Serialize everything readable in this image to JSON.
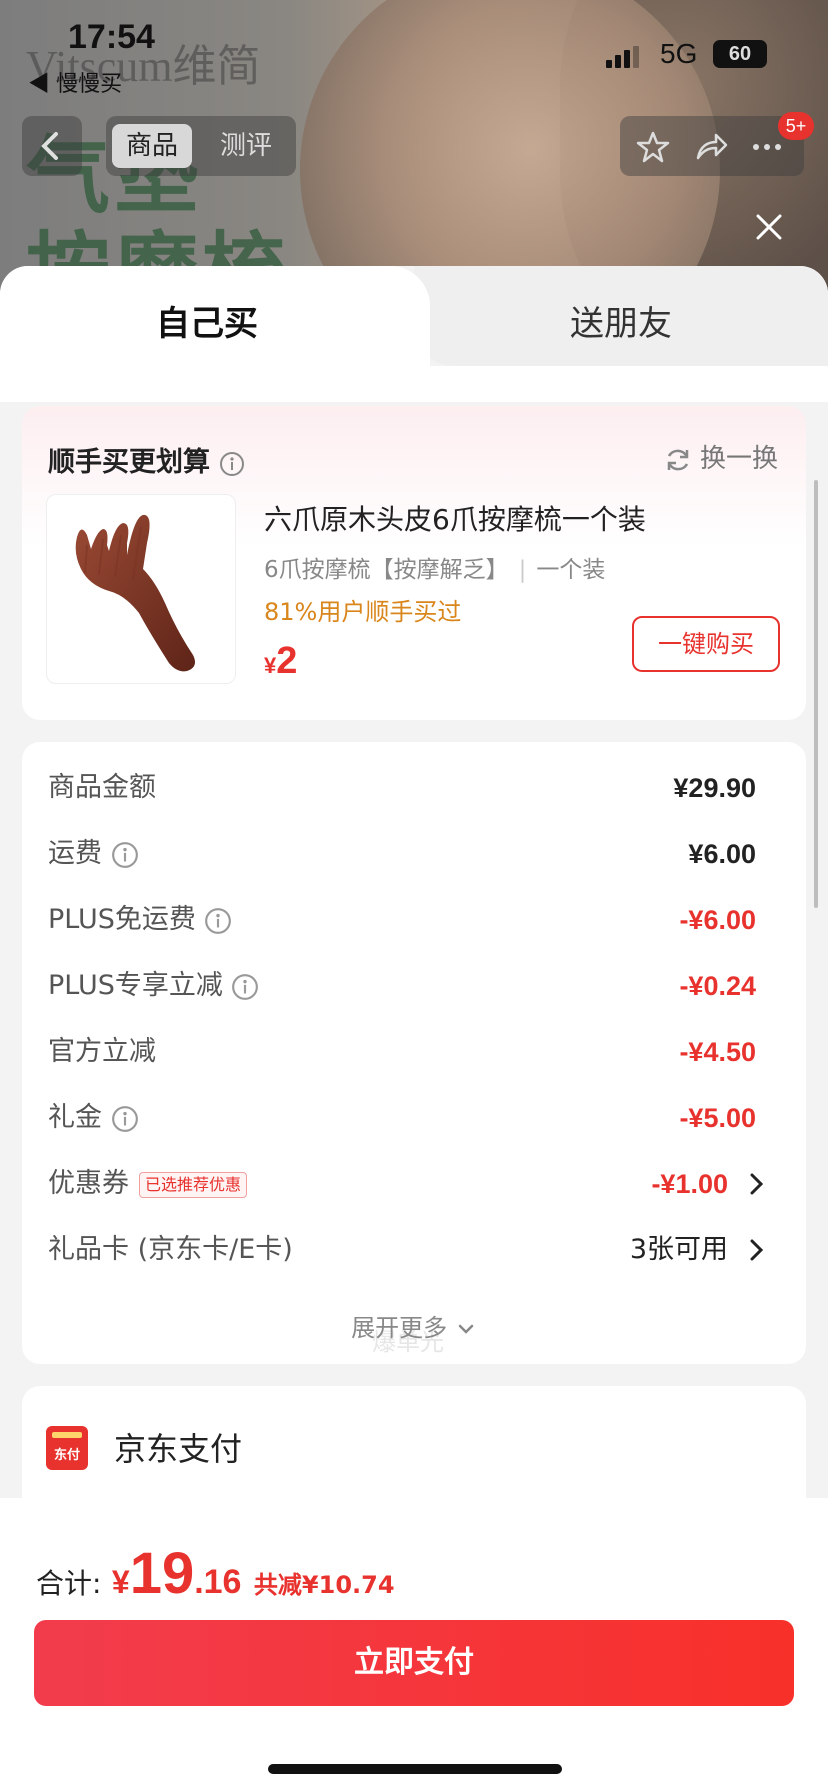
{
  "status_bar": {
    "time": "17:54",
    "back_app": "◀ 慢慢买",
    "network": "5G",
    "battery": "60"
  },
  "background_page": {
    "brand_text": "Vitscum维简",
    "product_text": "气垫\n按摩梳"
  },
  "product_nav": {
    "tabs": [
      "商品",
      "测评"
    ],
    "cart_badge": "5+"
  },
  "sheet": {
    "tabs": {
      "self": "自己买",
      "gift": "送朋友"
    },
    "addon": {
      "title": "顺手买更划算",
      "swap_label": "换一换",
      "product_name": "六爪原木头皮6爪按摩梳一个装",
      "spec": "6爪按摩梳【按摩解乏】",
      "spec2": "一个装",
      "stat": "81%用户顺手买过",
      "currency": "¥",
      "price": "2",
      "buy_label": "一键购买"
    },
    "price_rows": [
      {
        "label": "商品金额",
        "value": "¥29.90",
        "info": false,
        "red": false
      },
      {
        "label": "运费",
        "value": "¥6.00",
        "info": true,
        "red": false
      },
      {
        "label": "PLUS免运费",
        "value": "-¥6.00",
        "info": true,
        "red": true
      },
      {
        "label": "PLUS专享立减",
        "value": "-¥0.24",
        "info": true,
        "red": true
      },
      {
        "label": "官方立减",
        "value": "-¥4.50",
        "info": false,
        "red": true
      },
      {
        "label": "礼金",
        "value": "-¥5.00",
        "info": true,
        "red": true
      },
      {
        "label": "优惠券",
        "tag": "已选推荐优惠",
        "value": "-¥1.00",
        "red": true,
        "chevron": true
      },
      {
        "label": "礼品卡 (京东卡/E卡)",
        "value": "3张可用",
        "red": false,
        "chevron": true
      }
    ],
    "expand_label": "展开更多",
    "watermark": "爆单光",
    "payment": {
      "icon_text": "东付",
      "label": "京东支付"
    }
  },
  "footer": {
    "total_label": "合计:",
    "currency": "¥",
    "total_int": "19",
    "total_dec": ".16",
    "saved": "共减¥10.74",
    "pay_button": "立即支付"
  },
  "colors": {
    "accent_red": "#e8322e",
    "orange": "#d9861c"
  }
}
